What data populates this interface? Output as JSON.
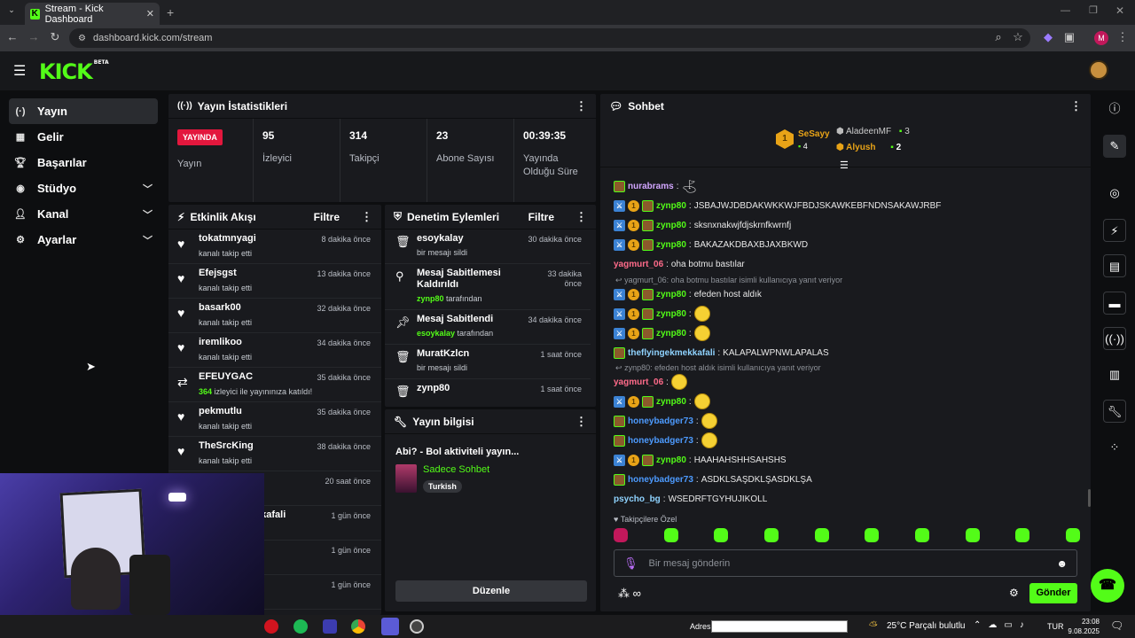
{
  "browser": {
    "tab_title": "Stream - Kick Dashboard",
    "url": "dashboard.kick.com/stream",
    "profile_initial": "M"
  },
  "header": {
    "logo": "KICK",
    "logo_badge": "BETA"
  },
  "sidebar": {
    "items": [
      {
        "label": "Yayın",
        "icon": "broadcast-icon",
        "active": true
      },
      {
        "label": "Gelir",
        "icon": "revenue-icon"
      },
      {
        "label": "Başarılar",
        "icon": "trophy-icon"
      },
      {
        "label": "Stüdyo",
        "icon": "studio-icon",
        "expandable": true
      },
      {
        "label": "Kanal",
        "icon": "channel-icon",
        "expandable": true
      },
      {
        "label": "Ayarlar",
        "icon": "gear-icon",
        "expandable": true
      }
    ]
  },
  "stats": {
    "title": "Yayın İstatistikleri",
    "live_badge": "YAYINDA",
    "live_label": "Yayın",
    "cells": [
      {
        "value": "95",
        "label": "İzleyici"
      },
      {
        "value": "314",
        "label": "Takipçi"
      },
      {
        "value": "23",
        "label": "Abone Sayısı"
      },
      {
        "value": "00:39:35",
        "label": "Yayında Olduğu Süre"
      }
    ]
  },
  "activity": {
    "title": "Etkinlik Akışı",
    "filter": "Filtre",
    "items": [
      {
        "name": "tokatmnyagi",
        "sub": "kanalı takip etti",
        "time": "8 dakika önce",
        "icon": "heart-icon"
      },
      {
        "name": "Efejsgst",
        "sub": "kanalı takip etti",
        "time": "13 dakika önce",
        "icon": "heart-icon"
      },
      {
        "name": "basark00",
        "sub": "kanalı takip etti",
        "time": "32 dakika önce",
        "icon": "heart-icon"
      },
      {
        "name": "iremlikoo",
        "sub": "kanalı takip etti",
        "time": "34 dakika önce",
        "icon": "heart-icon"
      },
      {
        "name": "EFEUYGAC",
        "sub_count": "364",
        "sub": " izleyici ile yayınınıza katıldı!",
        "time": "35 dakika önce",
        "icon": "raid-icon"
      },
      {
        "name": "pekmutlu",
        "sub": "kanalı takip etti",
        "time": "35 dakika önce",
        "icon": "heart-icon"
      },
      {
        "name": "TheSrcKing",
        "sub": "kanalı takip etti",
        "time": "38 dakika önce",
        "icon": "heart-icon"
      },
      {
        "name": "",
        "sub": "",
        "time": "20 saat önce",
        "icon": ""
      },
      {
        "name": "kkafali",
        "sub": "",
        "time": "1 gün önce",
        "icon": ""
      },
      {
        "name": "",
        "sub": "",
        "time": "1 gün önce",
        "icon": ""
      },
      {
        "name": "",
        "sub": "",
        "time": "1 gün önce",
        "icon": ""
      }
    ]
  },
  "moderation": {
    "title": "Denetim Eylemleri",
    "filter": "Filtre",
    "items": [
      {
        "name": "esoykalay",
        "sub": "bir mesajı sildi",
        "time": "30 dakika önce",
        "icon": "trash-icon"
      },
      {
        "name": "Mesaj Sabitlemesi Kaldırıldı",
        "by": "zynp80",
        "sub": " tarafından",
        "time": "33 dakika önce",
        "icon": "unpin-icon"
      },
      {
        "name": "Mesaj Sabitlendi",
        "by": "esoykalay",
        "sub": " tarafından",
        "time": "34 dakika önce",
        "icon": "pin-icon"
      },
      {
        "name": "MuratKzlcn",
        "sub": "bir mesajı sildi",
        "time": "1 saat önce",
        "icon": "trash-icon"
      },
      {
        "name": "zynp80",
        "sub": "",
        "time": "1 saat önce",
        "icon": "trash-icon"
      }
    ]
  },
  "stream_info": {
    "title": "Yayın bilgisi",
    "stream_title": "Abi? - Bol aktiviteli yayın...",
    "category": "Sadece Sohbet",
    "tag": "Turkish",
    "edit_button": "Düzenle"
  },
  "chat": {
    "title": "Sohbet",
    "leaderboard": [
      {
        "rank": "1",
        "name": "SeSayy",
        "count": "4"
      },
      {
        "name": "AladeenMF",
        "count": "3"
      },
      {
        "name": "Alyush",
        "count": "2"
      }
    ],
    "messages": [
      {
        "user": "nurabrams",
        "text": "",
        "color": "#d2a6ff",
        "badges": [
          "ava"
        ],
        "emote": "cone"
      },
      {
        "user": "zynp80",
        "text": "JSBAJWJDBDAKWKKWJFBDJSKAWKEBFNDNSAKAWJRBF",
        "color": "#53fc18",
        "badges": [
          "mod",
          "sub",
          "ava"
        ]
      },
      {
        "user": "zynp80",
        "text": "sksnxnakwjfdjskrnfkwrnfj",
        "color": "#53fc18",
        "badges": [
          "mod",
          "sub",
          "ava"
        ]
      },
      {
        "user": "zynp80",
        "text": "BAKAZAKDBAXBJAXBKWD",
        "color": "#53fc18",
        "badges": [
          "mod",
          "sub",
          "ava"
        ]
      },
      {
        "user": "yagmurt_06",
        "text": "oha botmu bastılar",
        "color": "#ff6b8a",
        "badges": []
      },
      {
        "reply": "yagmurt_06: oha botmu bastılar isimli kullanıcıya yanıt veriyor"
      },
      {
        "user": "zynp80",
        "text": "efeden host aldık",
        "color": "#53fc18",
        "badges": [
          "mod",
          "sub",
          "ava"
        ]
      },
      {
        "user": "zynp80",
        "text": "",
        "color": "#53fc18",
        "badges": [
          "mod",
          "sub",
          "ava"
        ],
        "emote": "face"
      },
      {
        "user": "zynp80",
        "text": "",
        "color": "#53fc18",
        "badges": [
          "mod",
          "sub",
          "ava"
        ],
        "emote": "face"
      },
      {
        "user": "theflyingekmekkafali",
        "text": "KALAPALWPNWLAPALAS",
        "color": "#8fd3ff",
        "badges": [
          "ava"
        ]
      },
      {
        "reply": "zynp80: efeden host aldık isimli kullanıcıya yanıt veriyor"
      },
      {
        "user": "yagmurt_06",
        "text": "",
        "color": "#ff6b8a",
        "badges": [],
        "emote": "face"
      },
      {
        "user": "zynp80",
        "text": "",
        "color": "#53fc18",
        "badges": [
          "mod",
          "sub",
          "ava"
        ],
        "emote": "face"
      },
      {
        "user": "honeybadger73",
        "text": "",
        "color": "#4d9bff",
        "badges": [
          "ava"
        ],
        "emote": "face"
      },
      {
        "user": "honeybadger73",
        "text": "",
        "color": "#4d9bff",
        "badges": [
          "ava"
        ],
        "emote": "face"
      },
      {
        "user": "zynp80",
        "text": "HAAHAHSHHSAHSHS",
        "color": "#53fc18",
        "badges": [
          "mod",
          "sub",
          "ava"
        ]
      },
      {
        "user": "honeybadger73",
        "text": "ASDKLSAŞDKLŞASDKLŞA",
        "color": "#4d9bff",
        "badges": [
          "ava"
        ]
      },
      {
        "user": "psycho_bg",
        "text": "WSEDRFTGYHUJIKOLL",
        "color": "#8fd3ff",
        "badges": []
      }
    ],
    "followers_only": "Takipçilere Özel",
    "input_placeholder": "Bir mesaj gönderin",
    "send_button": "Gönder"
  },
  "taskbar": {
    "address_label": "Adres",
    "weather": "25°C  Parçalı bulutlu",
    "language": "TUR",
    "time": "23:08",
    "date": "9.08.2025"
  }
}
